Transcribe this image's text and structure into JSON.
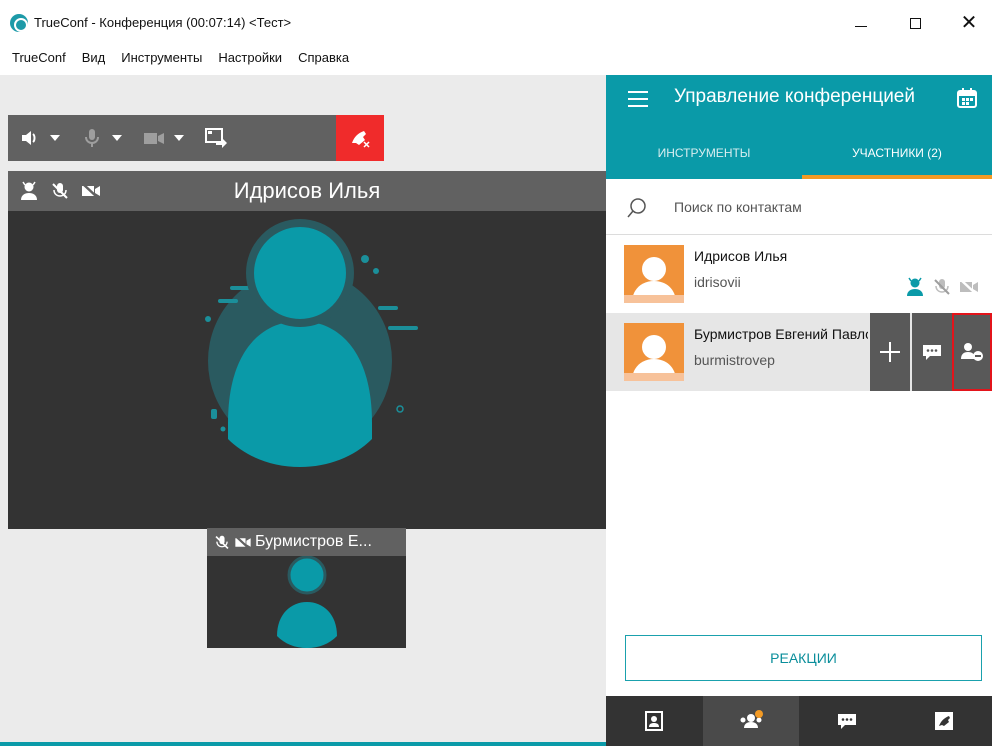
{
  "window": {
    "title": "TrueConf - Конференция (00:07:14) <Тест>",
    "minimize_icon": "minimize-icon",
    "maximize_icon": "maximize-icon",
    "close_glyph": "✕"
  },
  "menu": {
    "items": [
      {
        "label": "TrueConf"
      },
      {
        "label": "Вид"
      },
      {
        "label": "Инструменты"
      },
      {
        "label": "Настройки"
      },
      {
        "label": "Справка"
      }
    ]
  },
  "toolbar": {
    "icons": [
      "speaker-icon",
      "microphone-icon",
      "camera-icon",
      "share-screen-icon",
      "hangup-icon"
    ]
  },
  "main_video": {
    "name": "Идрисов Илья",
    "status_icons": [
      "owner-icon",
      "mic-off-icon",
      "camera-off-icon"
    ]
  },
  "thumbnail": {
    "name": "Бурмистров Е..."
  },
  "panel": {
    "title": "Управление конференцией",
    "tabs": [
      {
        "label": "ИНСТРУМЕНТЫ"
      },
      {
        "label": "УЧАСТНИКИ (2)"
      }
    ],
    "active_tab": "УЧАСТНИКИ (2)",
    "search": {
      "placeholder": "Поиск по контактам",
      "value": ""
    },
    "participants": [
      {
        "name": "Идрисов Илья",
        "login": "idrisovii"
      },
      {
        "name": "Бурмистров Евгений Павлович",
        "login": "burmistrovep"
      }
    ],
    "reactions_label": "РЕАКЦИИ",
    "bottom_nav": [
      "address-book-icon",
      "participants-icon",
      "chat-icon",
      "call-icon"
    ]
  },
  "colors": {
    "accent": "#0a9aa8",
    "tab_underline": "#f39a24",
    "hangup": "#f02b2b",
    "avatar": "#f0923a",
    "highlight_border": "#e3141b"
  }
}
